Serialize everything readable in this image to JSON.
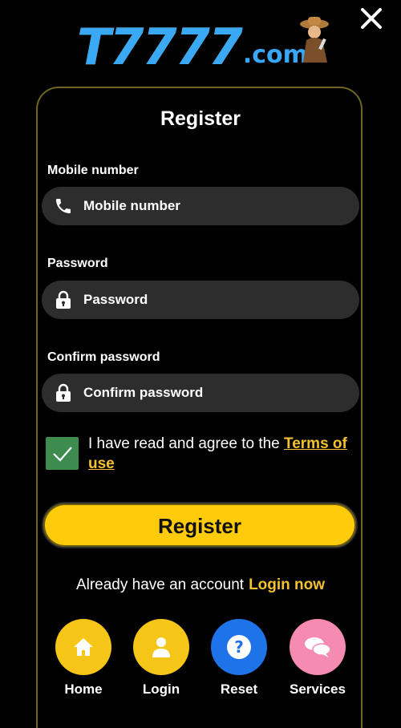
{
  "logo": {
    "main": "T7777",
    "suffix": ".com"
  },
  "header": {
    "close_icon": "close-icon"
  },
  "form": {
    "title": "Register",
    "mobile": {
      "label": "Mobile number",
      "placeholder": "Mobile number",
      "value": "",
      "icon": "phone-icon"
    },
    "password": {
      "label": "Password",
      "placeholder": "Password",
      "value": "",
      "icon": "lock-icon"
    },
    "confirm": {
      "label": "Confirm password",
      "placeholder": "Confirm password",
      "value": "",
      "icon": "lock-icon"
    },
    "agree": {
      "checked": true,
      "text": "I have read and agree to the ",
      "link": "Terms of use"
    },
    "submit_label": "Register",
    "login_prompt": "Already have an account",
    "login_link": "Login now"
  },
  "nav": [
    {
      "label": "Home",
      "icon": "home-icon",
      "color": "#f5c518"
    },
    {
      "label": "Login",
      "icon": "user-icon",
      "color": "#f5c518"
    },
    {
      "label": "Reset",
      "icon": "question-icon",
      "color": "#1e73e8"
    },
    {
      "label": "Services",
      "icon": "chat-icon",
      "color": "#f58bb0"
    }
  ],
  "colors": {
    "accent": "#ffcb0a",
    "link": "#f2c230",
    "field_bg": "#2d2d2d",
    "check": "#3e8b4f",
    "panel_border": "#6e6520"
  }
}
